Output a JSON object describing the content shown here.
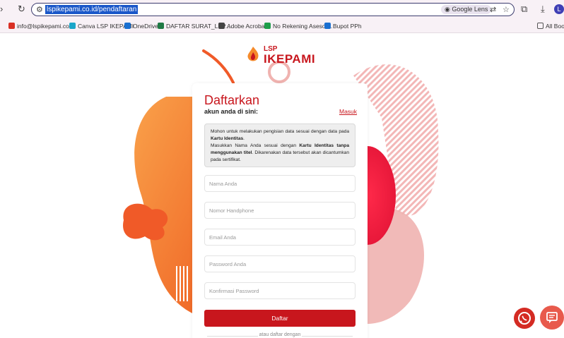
{
  "browser": {
    "url": "lspikepami.co.id/pendaftaran",
    "lens_label": "Google Lens",
    "avatar_letter": "L",
    "bookmarks": [
      {
        "label": "info@lspikepami.co...",
        "icon": "gmail-icon",
        "color": "#d93025"
      },
      {
        "label": "Canva LSP IKEPAMI",
        "icon": "canva-icon",
        "color": "#1aa6c9"
      },
      {
        "label": "OneDrive",
        "icon": "onedrive-icon",
        "color": "#1a6fd0"
      },
      {
        "label": "DAFTAR SURAT_LSP...",
        "icon": "excel-icon",
        "color": "#1f7a44"
      },
      {
        "label": "Adobe Acrobat",
        "icon": "globe-icon",
        "color": "#444444"
      },
      {
        "label": "No Rekening Asesor...",
        "icon": "sheets-icon",
        "color": "#1e9e4a"
      },
      {
        "label": "Bupot PPh",
        "icon": "onedrive-icon",
        "color": "#1a6fd0"
      }
    ],
    "all_bookmarks_label": "All Book"
  },
  "logo": {
    "top": "LSP",
    "name": "IKEPAMI"
  },
  "form": {
    "title": "Daftarkan",
    "subtitle": "akun anda di sini:",
    "login_link": "Masuk",
    "note_line1": "Mohon untuk melakukan pengisian data sesuai dengan data pada ",
    "note_bold1": "Kartu Identitas",
    "note_line2": "Masukkan Nama Anda sesuai dengan ",
    "note_bold2": "Kartu Identitas tanpa menggunakan titel",
    "note_line3": ". Dikarenakan data tersebut akan dicantumkan pada sertifikat.",
    "fields": [
      {
        "placeholder": "Nama Anda"
      },
      {
        "placeholder": "Nomor Handphone"
      },
      {
        "placeholder": "Email Anda"
      },
      {
        "placeholder": "Password Anda"
      },
      {
        "placeholder": "Konfirmasi Password"
      }
    ],
    "submit_label": "Daftar",
    "alt_label": "atau daftar dengan"
  },
  "colors": {
    "brand_red": "#c8161d",
    "orange": "#f58a2a"
  }
}
